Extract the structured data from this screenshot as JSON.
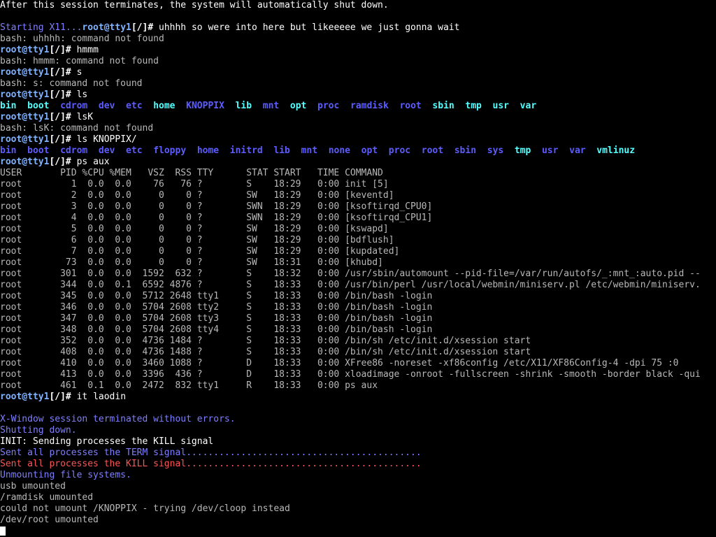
{
  "colors": {
    "background": "#000000",
    "text": "#b8b8b8",
    "prompt": "#7fb2ff",
    "info": "#7f7fff",
    "error": "#ff5555",
    "dir": "#5c5cff",
    "dir_cyan": "#55ffff"
  },
  "lines": [
    {
      "segs": [
        {
          "t": "After this session terminates, the system will automatically shut down.",
          "c": "white"
        }
      ]
    },
    {
      "segs": [
        {
          "t": "",
          "c": "gray"
        }
      ]
    },
    {
      "segs": [
        {
          "t": "Starting X11...",
          "c": "info"
        },
        {
          "t": "root@tty1",
          "c": "prompt"
        },
        {
          "t": "[/]#",
          "c": "prompt-sym"
        },
        {
          "t": " uhhhh so were into here but likeeeee we just gonna wait",
          "c": "white"
        }
      ]
    },
    {
      "segs": [
        {
          "t": "bash: uhhhh: command not found",
          "c": "gray"
        }
      ]
    },
    {
      "segs": [
        {
          "t": "root@tty1",
          "c": "prompt"
        },
        {
          "t": "[/]#",
          "c": "prompt-sym"
        },
        {
          "t": " hmmm",
          "c": "white"
        }
      ]
    },
    {
      "segs": [
        {
          "t": "bash: hmmm: command not found",
          "c": "gray"
        }
      ]
    },
    {
      "segs": [
        {
          "t": "root@tty1",
          "c": "prompt"
        },
        {
          "t": "[/]#",
          "c": "prompt-sym"
        },
        {
          "t": " s",
          "c": "white"
        }
      ]
    },
    {
      "segs": [
        {
          "t": "bash: s: command not found",
          "c": "gray"
        }
      ]
    },
    {
      "segs": [
        {
          "t": "root@tty1",
          "c": "prompt"
        },
        {
          "t": "[/]#",
          "c": "prompt-sym"
        },
        {
          "t": " ls",
          "c": "white"
        }
      ]
    },
    {
      "segs": [
        {
          "t": "bin",
          "c": "dir-cyan"
        },
        {
          "t": "  ",
          "c": "gray"
        },
        {
          "t": "boot",
          "c": "dir-cyan"
        },
        {
          "t": "  ",
          "c": "gray"
        },
        {
          "t": "cdrom",
          "c": "dir"
        },
        {
          "t": "  ",
          "c": "gray"
        },
        {
          "t": "dev",
          "c": "dir"
        },
        {
          "t": "  ",
          "c": "gray"
        },
        {
          "t": "etc",
          "c": "dir"
        },
        {
          "t": "  ",
          "c": "gray"
        },
        {
          "t": "home",
          "c": "dir-cyan"
        },
        {
          "t": "  ",
          "c": "gray"
        },
        {
          "t": "KNOPPIX",
          "c": "dir"
        },
        {
          "t": "  ",
          "c": "gray"
        },
        {
          "t": "lib",
          "c": "dir-cyan"
        },
        {
          "t": "  ",
          "c": "gray"
        },
        {
          "t": "mnt",
          "c": "dir"
        },
        {
          "t": "  ",
          "c": "gray"
        },
        {
          "t": "opt",
          "c": "dir-cyan"
        },
        {
          "t": "  ",
          "c": "gray"
        },
        {
          "t": "proc",
          "c": "dir"
        },
        {
          "t": "  ",
          "c": "gray"
        },
        {
          "t": "ramdisk",
          "c": "dir"
        },
        {
          "t": "  ",
          "c": "gray"
        },
        {
          "t": "root",
          "c": "dir"
        },
        {
          "t": "  ",
          "c": "gray"
        },
        {
          "t": "sbin",
          "c": "dir-cyan"
        },
        {
          "t": "  ",
          "c": "gray"
        },
        {
          "t": "tmp",
          "c": "dir-cyan"
        },
        {
          "t": "  ",
          "c": "gray"
        },
        {
          "t": "usr",
          "c": "dir-cyan"
        },
        {
          "t": "  ",
          "c": "gray"
        },
        {
          "t": "var",
          "c": "dir-cyan"
        }
      ]
    },
    {
      "segs": [
        {
          "t": "root@tty1",
          "c": "prompt"
        },
        {
          "t": "[/]#",
          "c": "prompt-sym"
        },
        {
          "t": " lsK",
          "c": "white"
        }
      ]
    },
    {
      "segs": [
        {
          "t": "bash: lsK: command not found",
          "c": "gray"
        }
      ]
    },
    {
      "segs": [
        {
          "t": "root@tty1",
          "c": "prompt"
        },
        {
          "t": "[/]#",
          "c": "prompt-sym"
        },
        {
          "t": " ls KNOPPIX/",
          "c": "white"
        }
      ]
    },
    {
      "segs": [
        {
          "t": "bin",
          "c": "dir"
        },
        {
          "t": "  ",
          "c": "gray"
        },
        {
          "t": "boot",
          "c": "dir"
        },
        {
          "t": "  ",
          "c": "gray"
        },
        {
          "t": "cdrom",
          "c": "dir"
        },
        {
          "t": "  ",
          "c": "gray"
        },
        {
          "t": "dev",
          "c": "dir"
        },
        {
          "t": "  ",
          "c": "gray"
        },
        {
          "t": "etc",
          "c": "dir"
        },
        {
          "t": "  ",
          "c": "gray"
        },
        {
          "t": "floppy",
          "c": "dir"
        },
        {
          "t": "  ",
          "c": "gray"
        },
        {
          "t": "home",
          "c": "dir"
        },
        {
          "t": "  ",
          "c": "gray"
        },
        {
          "t": "initrd",
          "c": "dir"
        },
        {
          "t": "  ",
          "c": "gray"
        },
        {
          "t": "lib",
          "c": "dir"
        },
        {
          "t": "  ",
          "c": "gray"
        },
        {
          "t": "mnt",
          "c": "dir"
        },
        {
          "t": "  ",
          "c": "gray"
        },
        {
          "t": "none",
          "c": "dir"
        },
        {
          "t": "  ",
          "c": "gray"
        },
        {
          "t": "opt",
          "c": "dir"
        },
        {
          "t": "  ",
          "c": "gray"
        },
        {
          "t": "proc",
          "c": "dir"
        },
        {
          "t": "  ",
          "c": "gray"
        },
        {
          "t": "root",
          "c": "dir"
        },
        {
          "t": "  ",
          "c": "gray"
        },
        {
          "t": "sbin",
          "c": "dir"
        },
        {
          "t": "  ",
          "c": "gray"
        },
        {
          "t": "sys",
          "c": "dir"
        },
        {
          "t": "  ",
          "c": "gray"
        },
        {
          "t": "tmp",
          "c": "dir-cyan"
        },
        {
          "t": "  ",
          "c": "gray"
        },
        {
          "t": "usr",
          "c": "dir"
        },
        {
          "t": "  ",
          "c": "gray"
        },
        {
          "t": "var",
          "c": "dir"
        },
        {
          "t": "  ",
          "c": "gray"
        },
        {
          "t": "vmlinuz",
          "c": "dir-cyan"
        }
      ]
    },
    {
      "segs": [
        {
          "t": "root@tty1",
          "c": "prompt"
        },
        {
          "t": "[/]#",
          "c": "prompt-sym"
        },
        {
          "t": " ps aux",
          "c": "white"
        }
      ]
    },
    {
      "segs": [
        {
          "t": "USER       PID %CPU %MEM   VSZ  RSS TTY      STAT START   TIME COMMAND",
          "c": "gray"
        }
      ]
    },
    {
      "segs": [
        {
          "t": "root         1  0.0  0.0    76   76 ?        S    18:29   0:00 init [5]",
          "c": "gray"
        }
      ]
    },
    {
      "segs": [
        {
          "t": "root         2  0.0  0.0     0    0 ?        SW   18:29   0:00 [keventd]",
          "c": "gray"
        }
      ]
    },
    {
      "segs": [
        {
          "t": "root         3  0.0  0.0     0    0 ?        SWN  18:29   0:00 [ksoftirqd_CPU0]",
          "c": "gray"
        }
      ]
    },
    {
      "segs": [
        {
          "t": "root         4  0.0  0.0     0    0 ?        SWN  18:29   0:00 [ksoftirqd_CPU1]",
          "c": "gray"
        }
      ]
    },
    {
      "segs": [
        {
          "t": "root         5  0.0  0.0     0    0 ?        SW   18:29   0:00 [kswapd]",
          "c": "gray"
        }
      ]
    },
    {
      "segs": [
        {
          "t": "root         6  0.0  0.0     0    0 ?        SW   18:29   0:00 [bdflush]",
          "c": "gray"
        }
      ]
    },
    {
      "segs": [
        {
          "t": "root         7  0.0  0.0     0    0 ?        SW   18:29   0:00 [kupdated]",
          "c": "gray"
        }
      ]
    },
    {
      "segs": [
        {
          "t": "root        73  0.0  0.0     0    0 ?        SW   18:31   0:00 [khubd]",
          "c": "gray"
        }
      ]
    },
    {
      "segs": [
        {
          "t": "root       301  0.0  0.0  1592  632 ?        S    18:32   0:00 /usr/sbin/automount --pid-file=/var/run/autofs/_:mnt_:auto.pid --",
          "c": "gray"
        }
      ]
    },
    {
      "segs": [
        {
          "t": "root       344  0.0  0.1  6592 4876 ?        S    18:33   0:00 /usr/bin/perl /usr/local/webmin/miniserv.pl /etc/webmin/miniserv.",
          "c": "gray"
        }
      ]
    },
    {
      "segs": [
        {
          "t": "root       345  0.0  0.0  5712 2648 tty1     S    18:33   0:00 /bin/bash -login",
          "c": "gray"
        }
      ]
    },
    {
      "segs": [
        {
          "t": "root       346  0.0  0.0  5704 2608 tty2     S    18:33   0:00 /bin/bash -login",
          "c": "gray"
        }
      ]
    },
    {
      "segs": [
        {
          "t": "root       347  0.0  0.0  5704 2608 tty3     S    18:33   0:00 /bin/bash -login",
          "c": "gray"
        }
      ]
    },
    {
      "segs": [
        {
          "t": "root       348  0.0  0.0  5704 2608 tty4     S    18:33   0:00 /bin/bash -login",
          "c": "gray"
        }
      ]
    },
    {
      "segs": [
        {
          "t": "root       352  0.0  0.0  4736 1484 ?        S    18:33   0:00 /bin/sh /etc/init.d/xsession start",
          "c": "gray"
        }
      ]
    },
    {
      "segs": [
        {
          "t": "root       408  0.0  0.0  4736 1488 ?        S    18:33   0:00 /bin/sh /etc/init.d/xsession start",
          "c": "gray"
        }
      ]
    },
    {
      "segs": [
        {
          "t": "root       410  0.0  0.0  3460 1088 ?        D    18:33   0:00 XFree86 -noreset -xf86config /etc/X11/XF86Config-4 -dpi 75 :0",
          "c": "gray"
        }
      ]
    },
    {
      "segs": [
        {
          "t": "root       413  0.0  0.0  3396  436 ?        D    18:33   0:00 xloadimage -onroot -fullscreen -shrink -smooth -border black -qui",
          "c": "gray"
        }
      ]
    },
    {
      "segs": [
        {
          "t": "root       461  0.1  0.0  2472  832 tty1     R    18:33   0:00 ps aux",
          "c": "gray"
        }
      ]
    },
    {
      "segs": [
        {
          "t": "root@tty1",
          "c": "prompt"
        },
        {
          "t": "[/]#",
          "c": "prompt-sym"
        },
        {
          "t": " it laodin",
          "c": "white"
        }
      ]
    },
    {
      "segs": [
        {
          "t": "",
          "c": "gray"
        }
      ]
    },
    {
      "segs": [
        {
          "t": "X-Window session terminated without errors.",
          "c": "info"
        }
      ]
    },
    {
      "segs": [
        {
          "t": "Shutting down.",
          "c": "info"
        }
      ]
    },
    {
      "segs": [
        {
          "t": "INIT: Sending processes the KILL signal",
          "c": "white"
        }
      ]
    },
    {
      "segs": [
        {
          "t": "Sent all processes the TERM signal...........................................",
          "c": "info"
        }
      ]
    },
    {
      "segs": [
        {
          "t": "Sent all processes the KILL signal...........................................",
          "c": "red"
        }
      ]
    },
    {
      "segs": [
        {
          "t": "Unmounting file systems.",
          "c": "info"
        }
      ]
    },
    {
      "segs": [
        {
          "t": "usb umounted",
          "c": "gray"
        }
      ]
    },
    {
      "segs": [
        {
          "t": "/ramdisk umounted",
          "c": "gray"
        }
      ]
    },
    {
      "segs": [
        {
          "t": "could not umount /KNOPPIX - trying /dev/cloop instead",
          "c": "gray"
        }
      ]
    },
    {
      "segs": [
        {
          "t": "/dev/root umounted",
          "c": "gray"
        }
      ]
    }
  ]
}
